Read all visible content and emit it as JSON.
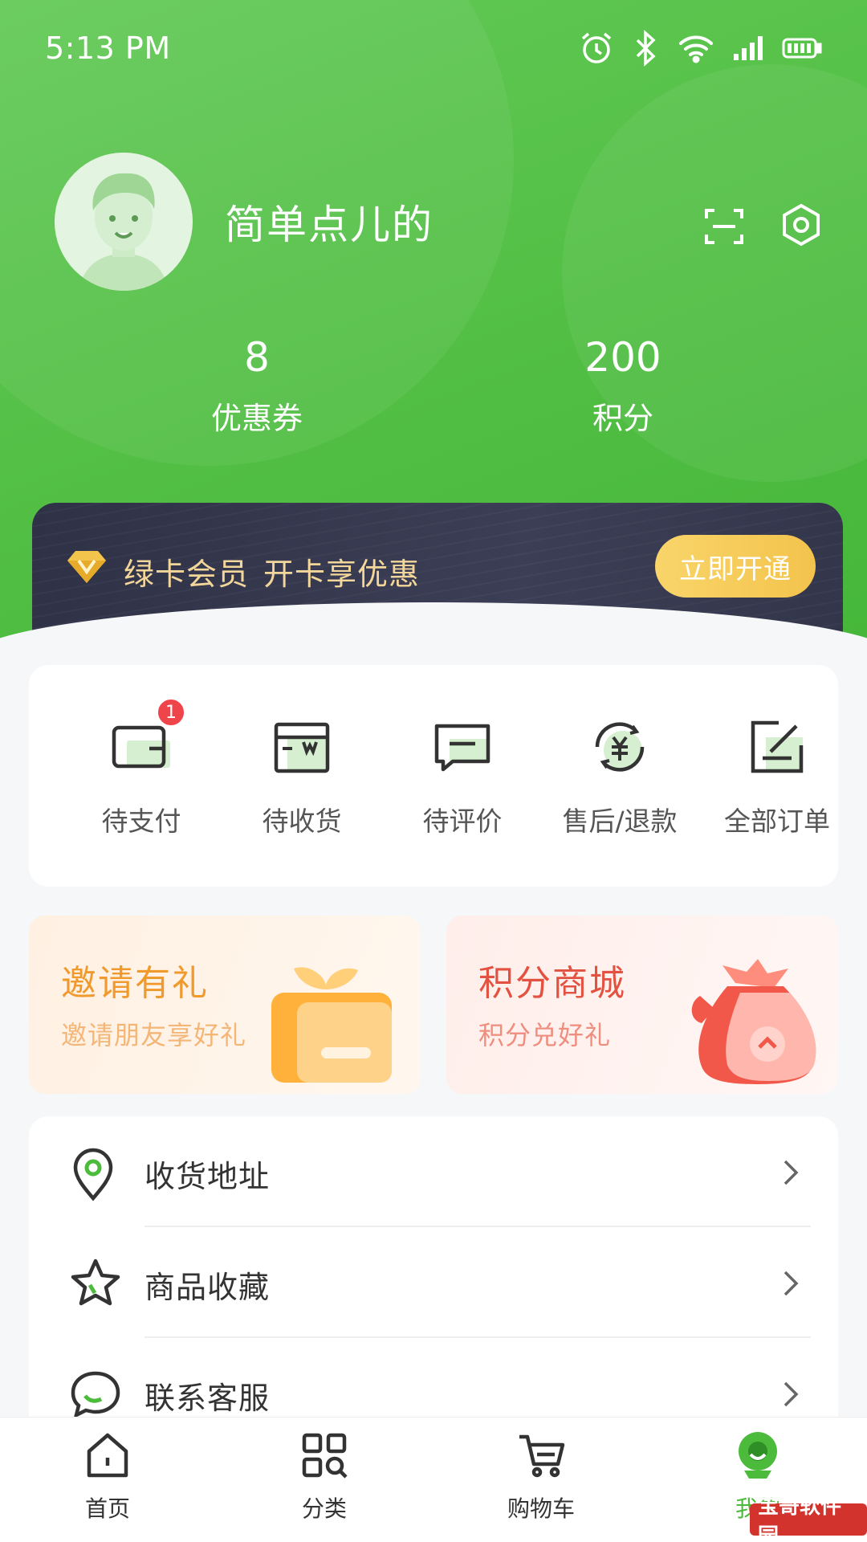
{
  "status_bar": {
    "time": "5:13 PM"
  },
  "profile": {
    "username": "简单点儿的"
  },
  "stats": [
    {
      "value": "8",
      "label": "优惠券"
    },
    {
      "value": "200",
      "label": "积分"
    }
  ],
  "vip": {
    "title": "绿卡会员",
    "subtitle": "开卡享优惠",
    "button": "立即开通"
  },
  "orders": [
    {
      "label": "待支付",
      "icon": "wallet-icon",
      "badge": "1"
    },
    {
      "label": "待收货",
      "icon": "package-icon"
    },
    {
      "label": "待评价",
      "icon": "comment-icon"
    },
    {
      "label": "售后/退款",
      "icon": "refund-icon"
    },
    {
      "label": "全部订单",
      "icon": "orders-icon"
    }
  ],
  "promos": [
    {
      "title": "邀请有礼",
      "subtitle": "邀请朋友享好礼"
    },
    {
      "title": "积分商城",
      "subtitle": "积分兑好礼"
    }
  ],
  "menu": [
    {
      "label": "收货地址",
      "icon": "location-pin-icon"
    },
    {
      "label": "商品收藏",
      "icon": "star-icon"
    },
    {
      "label": "联系客服",
      "icon": "chat-bubble-icon"
    }
  ],
  "tabbar": [
    {
      "label": "首页",
      "icon": "home-icon"
    },
    {
      "label": "分类",
      "icon": "category-icon"
    },
    {
      "label": "购物车",
      "icon": "cart-icon"
    },
    {
      "label": "我的",
      "icon": "profile-icon",
      "active": true
    }
  ],
  "watermark": "宝哥软件园",
  "colors": {
    "brand_green": "#52bf44",
    "vip_gold": "#f3c34c",
    "badge_red": "#f0444b"
  }
}
